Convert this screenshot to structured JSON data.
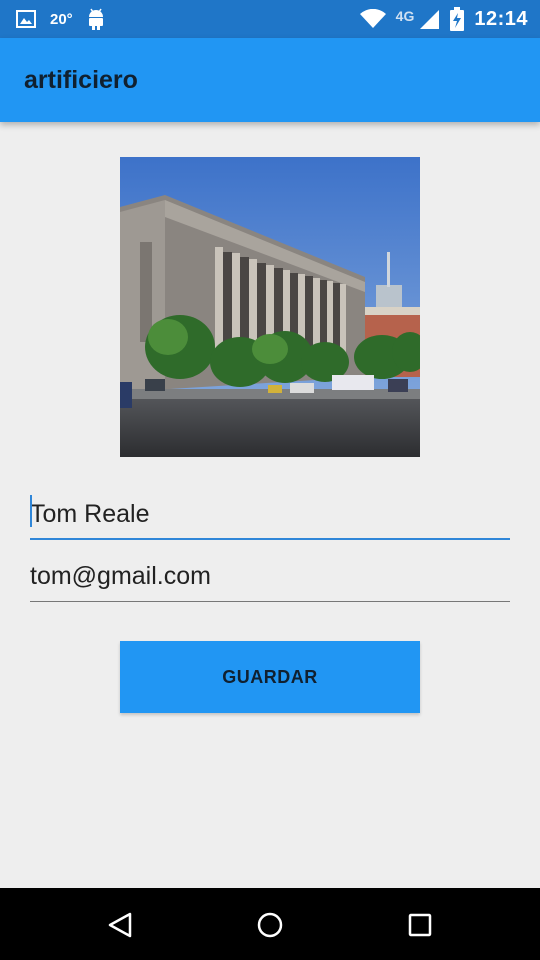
{
  "status_bar": {
    "temperature": "20°",
    "network": "4G",
    "time": "12:14",
    "icons": [
      "gallery-icon",
      "android-icon",
      "wifi-icon",
      "signal-icon",
      "battery-charging-icon"
    ]
  },
  "app_bar": {
    "title": "artificiero"
  },
  "photo": {
    "description_icon": "building-photo"
  },
  "form": {
    "name_value": "Tom Reale",
    "email_value": "tom@gmail.com"
  },
  "actions": {
    "save_label": "GUARDAR"
  },
  "nav": {
    "icons": [
      "back-icon",
      "home-icon",
      "recents-icon"
    ]
  },
  "colors": {
    "status_bar": "#1f76c8",
    "accent": "#2196f3",
    "background": "#eeeeee"
  }
}
